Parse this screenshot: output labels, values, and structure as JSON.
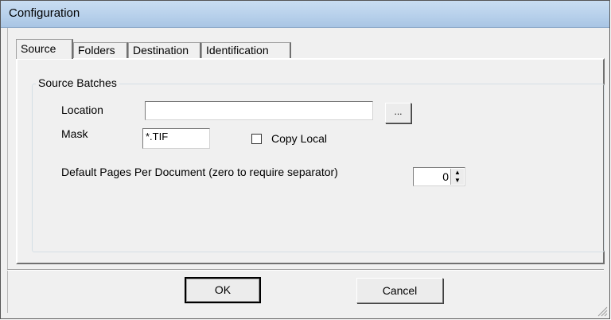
{
  "window": {
    "title": "Configuration"
  },
  "tabs": [
    {
      "label": "Source",
      "active": true
    },
    {
      "label": "Folders",
      "active": false
    },
    {
      "label": "Destination",
      "active": false
    },
    {
      "label": "Identification",
      "active": false
    }
  ],
  "group": {
    "label": "Source Batches"
  },
  "location": {
    "label": "Location",
    "value": "",
    "browse_label": "..."
  },
  "mask": {
    "label": "Mask",
    "value": "*.TIF"
  },
  "copy_local": {
    "label": "Copy Local",
    "checked": false
  },
  "pages": {
    "label": "Default Pages Per Document (zero to require separator)",
    "value": "0"
  },
  "buttons": {
    "ok": "OK",
    "cancel": "Cancel"
  },
  "icons": {
    "spin_up": "spin-up-arrow-icon",
    "spin_down": "spin-down-arrow-icon",
    "grip": "resize-grip-icon"
  }
}
